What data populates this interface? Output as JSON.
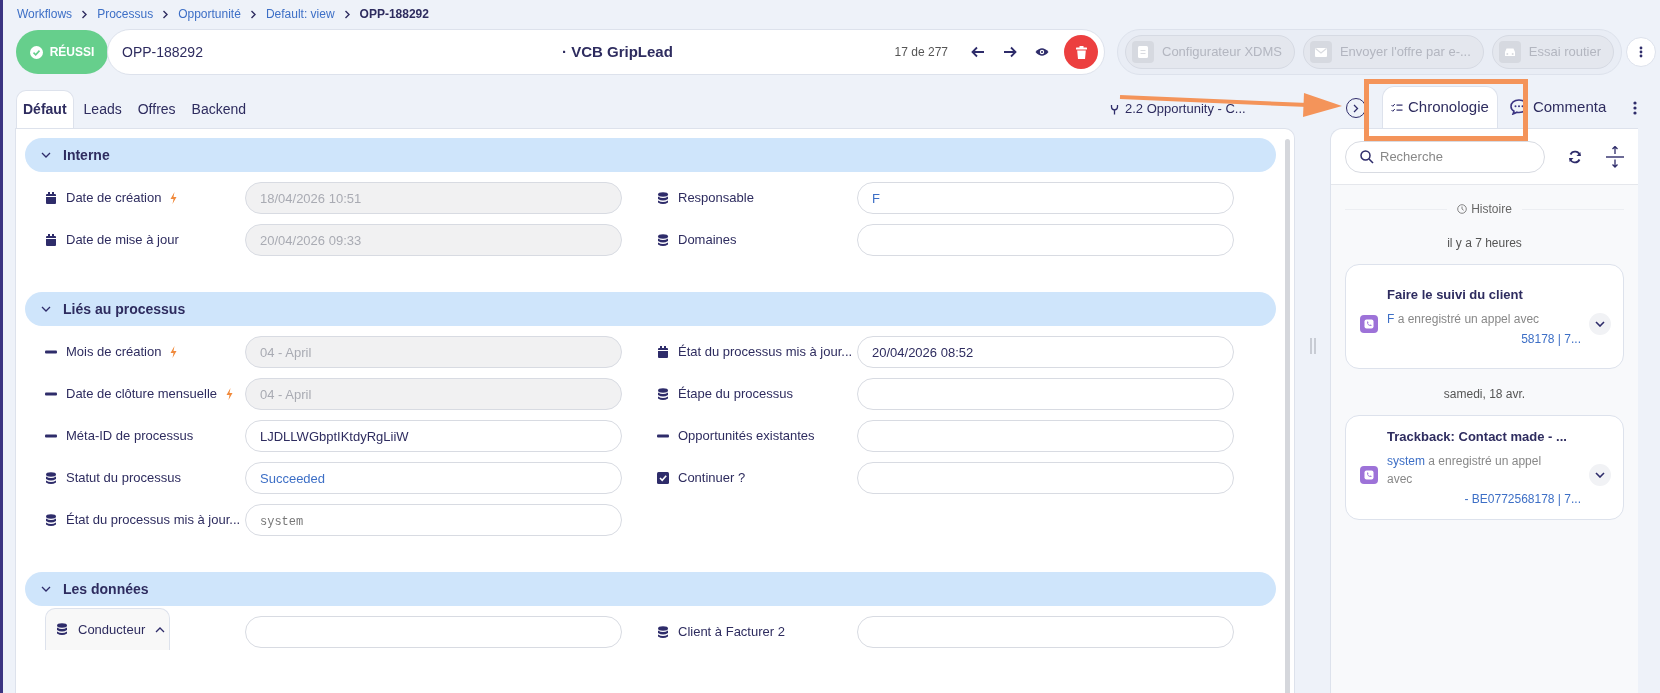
{
  "breadcrumb": [
    {
      "label": "Workflows",
      "current": false
    },
    {
      "label": "Processus",
      "current": false
    },
    {
      "label": "Opportunité",
      "current": false
    },
    {
      "label": "Default: view",
      "current": false
    },
    {
      "label": "OPP-188292",
      "current": true
    }
  ],
  "status_badge": {
    "label": "RÉUSSI"
  },
  "record": {
    "id": "OPP-188292",
    "title": "· VCB GripLead",
    "counter": "17 de 277"
  },
  "actions": [
    {
      "label": "Configurateur XDMS",
      "kind": "document",
      "disabled": true
    },
    {
      "label": "Envoyer l'offre par e-...",
      "kind": "envelope",
      "disabled": true
    },
    {
      "label": "Essai routier",
      "kind": "car",
      "disabled": true
    }
  ],
  "tabs": [
    {
      "label": "Défaut",
      "selected": true
    },
    {
      "label": "Leads",
      "selected": false
    },
    {
      "label": "Offres",
      "selected": false
    },
    {
      "label": "Backend",
      "selected": false
    }
  ],
  "flow": {
    "label": "2.2 Opportunity - C..."
  },
  "side_tabs": [
    {
      "label": "Chronologie",
      "kind": "list",
      "selected": true
    },
    {
      "label": "Commenta",
      "kind": "chat",
      "selected": false
    }
  ],
  "sections": [
    {
      "title": "Interne",
      "expanded": true,
      "left": [
        {
          "kind": "calendar",
          "label": "Date de création",
          "bolt": true,
          "value": "18/04/2026 10:51",
          "disabled": true
        },
        {
          "kind": "calendar",
          "label": "Date de mise à jour",
          "bolt": false,
          "value": "20/04/2026 09:33",
          "disabled": true
        }
      ],
      "right": [
        {
          "kind": "database",
          "label": "Responsable",
          "bolt": false,
          "value": "F",
          "disabled": false,
          "linked": true
        },
        {
          "kind": "database",
          "label": "Domaines",
          "bolt": false,
          "disabled": false
        }
      ]
    },
    {
      "title": "Liés au processus",
      "expanded": true,
      "left": [
        {
          "kind": "dash",
          "label": "Mois de création",
          "bolt": true,
          "value": "04 - April",
          "disabled": true
        },
        {
          "kind": "dash",
          "label": "Date de clôture mensuelle",
          "bolt": true,
          "value": "04 - April",
          "disabled": true
        },
        {
          "kind": "dash",
          "label": "Méta-ID de processus",
          "bolt": false,
          "value": "LJDLLWGbptIKtdyRgLiiW",
          "disabled": false,
          "linked": false
        },
        {
          "kind": "database",
          "label": "Statut du processus",
          "bolt": false,
          "value": "Succeeded",
          "disabled": false,
          "linked": true
        },
        {
          "kind": "database",
          "label": "État du processus mis à jour...",
          "bolt": false,
          "placeholder": "system",
          "disabled": false
        }
      ],
      "right": [
        {
          "kind": "calendar",
          "label": "État du processus mis à jour...",
          "bolt": false,
          "value": "20/04/2026 08:52",
          "disabled": false,
          "linked": false
        },
        {
          "kind": "database",
          "label": "Étape du processus",
          "bolt": false,
          "disabled": false
        },
        {
          "kind": "dash",
          "label": "Opportunités existantes",
          "bolt": false,
          "disabled": false
        },
        {
          "kind": "checkbox",
          "label": "Continuer ?",
          "bolt": false,
          "disabled": false
        }
      ]
    },
    {
      "title": "Les données",
      "expanded": true,
      "left": [
        {
          "kind": "database",
          "label": "Conducteur",
          "group_expanded": true,
          "disabled": false
        }
      ],
      "right": [
        {
          "kind": "database",
          "label": "Client à Facturer 2",
          "bolt": false,
          "disabled": false
        }
      ]
    }
  ],
  "timeline": {
    "search": {
      "placeholder": "Recherche"
    },
    "history_label": "Histoire",
    "groups": [
      {
        "date": "il y a 7 heures",
        "items": [
          {
            "title": "Faire le suivi du client",
            "actor": "F",
            "text": "a enregistré un appel avec",
            "ref": "58178 | 7..."
          }
        ]
      },
      {
        "date": "samedi, 18 avr.",
        "items": [
          {
            "title": "Trackback: Contact made - ...",
            "actor": "system",
            "text": "a enregistré un appel avec",
            "ref": "- BE0772568178 | 7..."
          }
        ]
      }
    ]
  }
}
